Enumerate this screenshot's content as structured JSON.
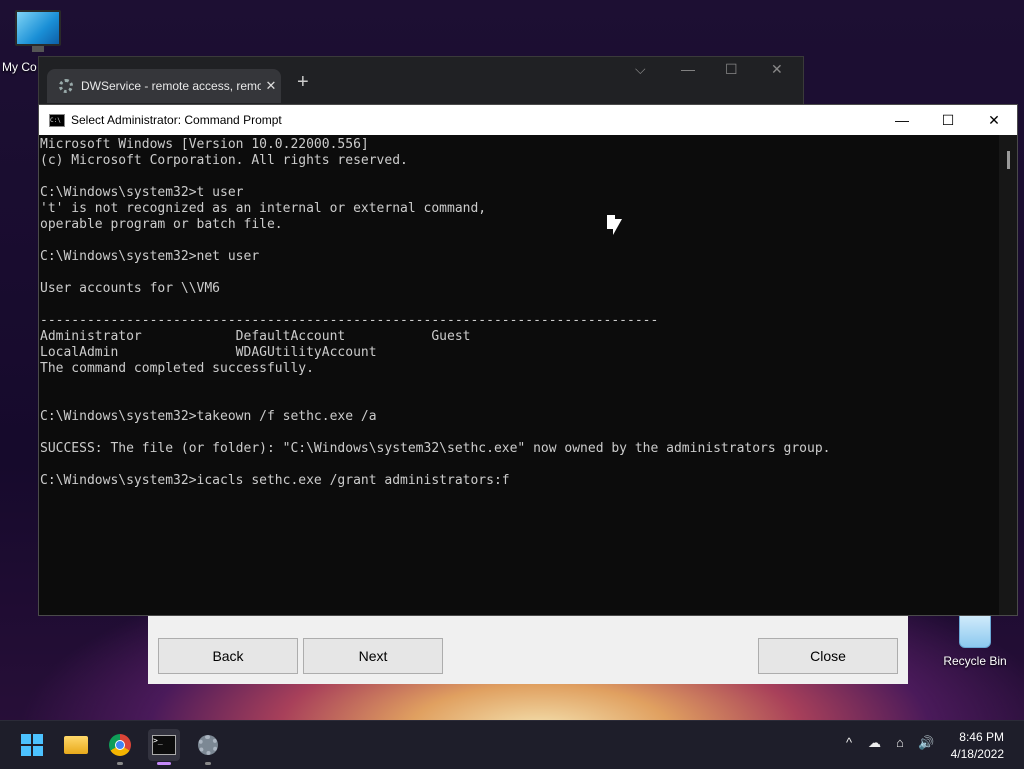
{
  "desktop": {
    "icons": [
      {
        "label": "My Co"
      },
      {
        "label": "Recycle Bin"
      }
    ]
  },
  "browser": {
    "tab_title": "DWService - remote access, remo",
    "new_tab": "+",
    "controls": {
      "dropdown": "⌵",
      "minimize": "—",
      "maximize": "☐",
      "close": "✕"
    }
  },
  "dialog": {
    "back_label": "Back",
    "next_label": "Next",
    "close_label": "Close"
  },
  "cmd": {
    "title": "Select Administrator: Command Prompt",
    "icon_text": "C:\\",
    "controls": {
      "minimize": "—",
      "maximize": "☐",
      "close": "✕"
    },
    "lines": [
      "Microsoft Windows [Version 10.0.22000.556]",
      "(c) Microsoft Corporation. All rights reserved.",
      "",
      "C:\\Windows\\system32>t user",
      "'t' is not recognized as an internal or external command,",
      "operable program or batch file.",
      "",
      "C:\\Windows\\system32>net user",
      "",
      "User accounts for \\\\VM6",
      "",
      "-------------------------------------------------------------------------------",
      "Administrator            DefaultAccount           Guest",
      "LocalAdmin               WDAGUtilityAccount",
      "The command completed successfully.",
      "",
      "",
      "C:\\Windows\\system32>takeown /f sethc.exe /a",
      "",
      "SUCCESS: The file (or folder): \"C:\\Windows\\system32\\sethc.exe\" now owned by the administrators group.",
      "",
      "C:\\Windows\\system32>icacls sethc.exe /grant administrators:f"
    ]
  },
  "taskbar": {
    "apps": [
      "start-icon",
      "file-explorer-icon",
      "chrome-icon",
      "command-prompt-icon",
      "dwservice-icon"
    ],
    "tray": {
      "chevron": "^",
      "network": "⌂",
      "speaker": "🔊"
    },
    "time": "8:46 PM",
    "date": "4/18/2022"
  }
}
